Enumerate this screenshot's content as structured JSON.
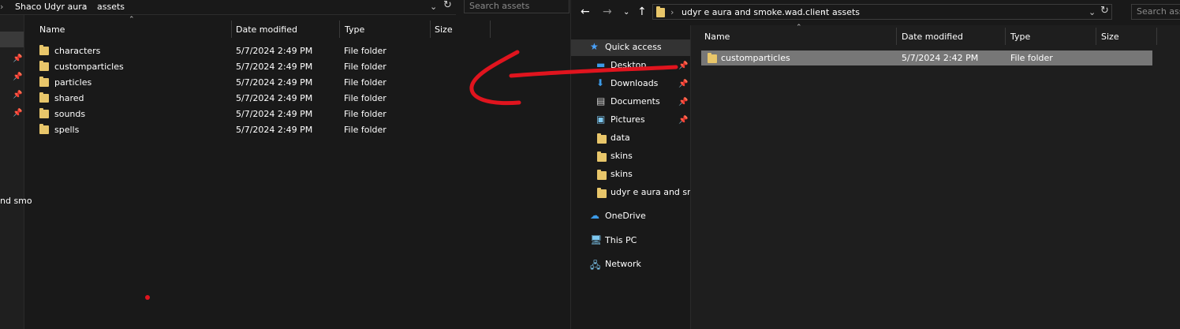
{
  "left_window": {
    "breadcrumb": [
      "Shaco Udyr aura",
      "assets"
    ],
    "search_placeholder": "Search assets",
    "columns": {
      "name": "Name",
      "date": "Date modified",
      "type": "Type",
      "size": "Size"
    },
    "rows": [
      {
        "name": "characters",
        "date": "5/7/2024 2:49 PM",
        "type": "File folder"
      },
      {
        "name": "customparticles",
        "date": "5/7/2024 2:49 PM",
        "type": "File folder"
      },
      {
        "name": "particles",
        "date": "5/7/2024 2:49 PM",
        "type": "File folder"
      },
      {
        "name": "shared",
        "date": "5/7/2024 2:49 PM",
        "type": "File folder"
      },
      {
        "name": "sounds",
        "date": "5/7/2024 2:49 PM",
        "type": "File folder"
      },
      {
        "name": "spells",
        "date": "5/7/2024 2:49 PM",
        "type": "File folder"
      }
    ],
    "nav_fragment": "nd smo"
  },
  "right_window": {
    "breadcrumb": [
      "udyr e aura and smoke.wad.client",
      "assets"
    ],
    "search_placeholder": "Search asse",
    "columns": {
      "name": "Name",
      "date": "Date modified",
      "type": "Type",
      "size": "Size"
    },
    "rows": [
      {
        "name": "customparticles",
        "date": "5/7/2024 2:42 PM",
        "type": "File folder"
      }
    ],
    "sidebar": {
      "quick_access": "Quick access",
      "pinned": [
        "Desktop",
        "Downloads",
        "Documents",
        "Pictures"
      ],
      "recent": [
        "data",
        "skins",
        "skins",
        "udyr e aura and smo"
      ],
      "onedrive": "OneDrive",
      "this_pc": "This PC",
      "network": "Network"
    }
  },
  "colors": {
    "annotation": "#e0141e",
    "folder": "#e8c66a",
    "selection": "#777777"
  }
}
